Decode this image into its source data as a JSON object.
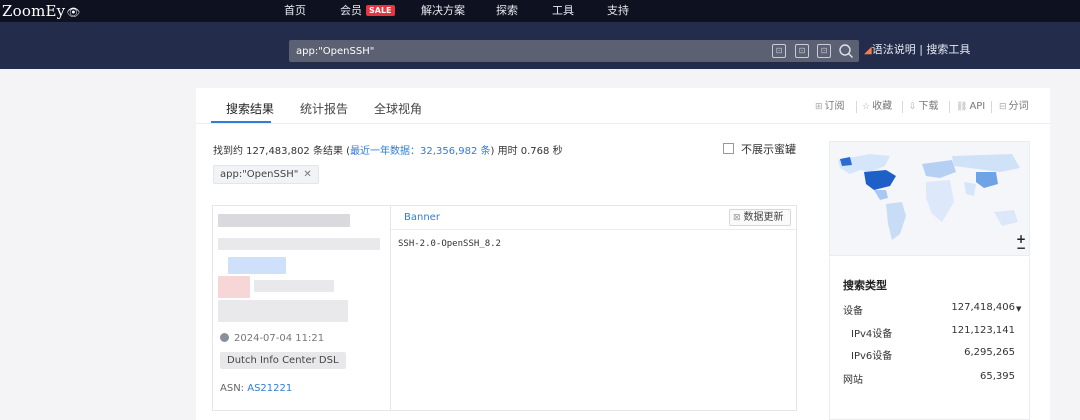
{
  "nav": {
    "logo": "ZoomEy",
    "items": [
      "首页",
      "会员",
      "解决方案",
      "探索",
      "工具",
      "支持"
    ],
    "sale_badge": "SALE"
  },
  "search": {
    "query": "app:\"OpenSSH\"",
    "help": "语法说明",
    "tools": "搜索工具"
  },
  "tabs": [
    "搜索结果",
    "统计报告",
    "全球视角"
  ],
  "toolbar": [
    "订阅",
    "收藏",
    "下载",
    "API",
    "分词"
  ],
  "summary": {
    "found_prefix": "找到约 127,483,802 条结果 (",
    "recent_year": "最近一年数据：32,356,982 条",
    "found_suffix": ") 用时 0.768 秒"
  },
  "honeypot_label": "不展示蜜罐",
  "filter_chip": "app:\"OpenSSH\"",
  "result": {
    "time": "2024-07-04 11:21",
    "org": "Dutch Info Center DSL",
    "asn_label": "ASN:",
    "asn_value": "AS21221",
    "banner_tab": "Banner",
    "update_button": "数据更新",
    "banner_text": "SSH-2.0-OpenSSH_8.2"
  },
  "map": {
    "zoom_in": "+",
    "zoom_out": "−"
  },
  "search_types": {
    "title": "搜索类型",
    "rows": [
      {
        "label": "设备",
        "value": "127,418,406"
      },
      {
        "label": "IPv4设备",
        "value": "121,123,141"
      },
      {
        "label": "IPv6设备",
        "value": "6,295,265"
      },
      {
        "label": "网站",
        "value": "65,395"
      }
    ]
  },
  "colors": {
    "accent": "#2f7dd6",
    "nav_bg": "#0d1120",
    "band_bg": "#232d4b",
    "sale": "#e8343c"
  }
}
